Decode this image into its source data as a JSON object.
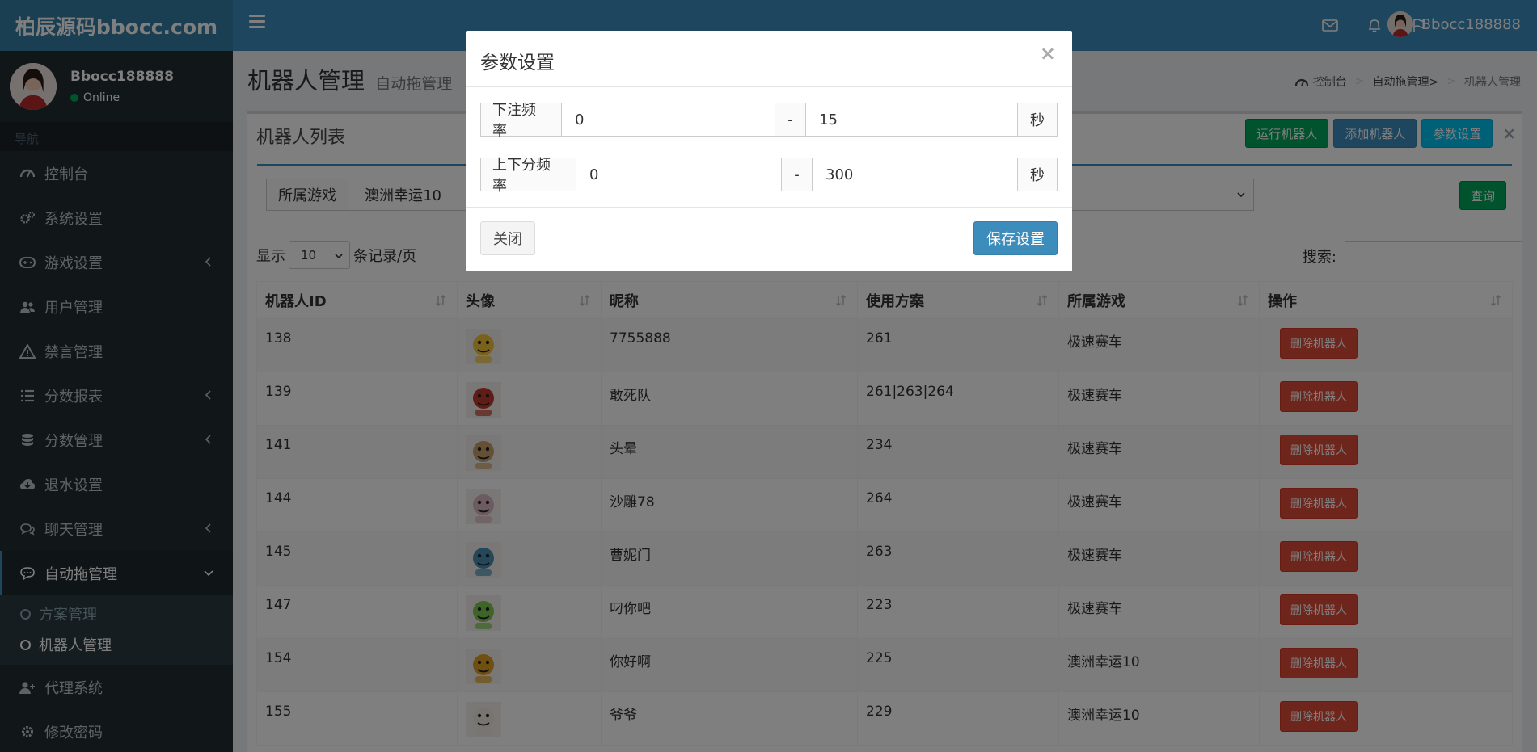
{
  "header": {
    "logo": "柏辰源码bbocc.com",
    "username": "Bbocc188888"
  },
  "sidebar": {
    "user": {
      "name": "Bbocc188888",
      "status": "Online"
    },
    "nav_header": "导航",
    "items": [
      {
        "label": "控制台",
        "icon": "dashboard-icon"
      },
      {
        "label": "系统设置",
        "icon": "cogs-icon"
      },
      {
        "label": "游戏设置",
        "icon": "gamepad-icon"
      },
      {
        "label": "用户管理",
        "icon": "users-icon"
      },
      {
        "label": "禁言管理",
        "icon": "warning-icon"
      },
      {
        "label": "分数报表",
        "icon": "list-icon"
      },
      {
        "label": "分数管理",
        "icon": "database-icon"
      },
      {
        "label": "退水设置",
        "icon": "cloud-download-icon"
      },
      {
        "label": "聊天管理",
        "icon": "comments-icon"
      },
      {
        "label": "自动拖管理",
        "icon": "comment-icon"
      },
      {
        "label": "代理系统",
        "icon": "user-plus-icon"
      },
      {
        "label": "修改密码",
        "icon": "gear-icon"
      }
    ],
    "submenu": [
      {
        "label": "方案管理"
      },
      {
        "label": "机器人管理"
      }
    ]
  },
  "page": {
    "title": "机器人管理",
    "subtitle": "自动拖管理",
    "breadcrumb": [
      "控制台",
      "自动拖管理>",
      "机器人管理"
    ]
  },
  "box": {
    "title": "机器人列表",
    "buttons": {
      "run": "运行机器人",
      "add": "添加机器人",
      "params": "参数设置",
      "close": "×"
    },
    "filter": {
      "label": "所属游戏",
      "value": "澳洲幸运10"
    },
    "query": "查询",
    "length": {
      "prefix": "显示",
      "value": "10",
      "suffix": "条记录/页"
    },
    "search_label": "搜索:"
  },
  "table": {
    "headers": [
      "机器人ID",
      "头像",
      "昵称",
      "使用方案",
      "所属游戏",
      "操作"
    ],
    "delete_label": "删除机器人",
    "rows": [
      {
        "id": "138",
        "nick": "7755888",
        "plan": "261",
        "game": "极速赛车",
        "av": "#f5c53a"
      },
      {
        "id": "139",
        "nick": "敢死队",
        "plan": "261|263|264",
        "game": "极速赛车",
        "av": "#c0392b"
      },
      {
        "id": "141",
        "nick": "头晕",
        "plan": "234",
        "game": "极速赛车",
        "av": "#c9a36b"
      },
      {
        "id": "144",
        "nick": "沙雕78",
        "plan": "264",
        "game": "极速赛车",
        "av": "#d9b7c2"
      },
      {
        "id": "145",
        "nick": "曹妮门",
        "plan": "263",
        "game": "极速赛车",
        "av": "#4a8fb5"
      },
      {
        "id": "147",
        "nick": "叼你吧",
        "plan": "223",
        "game": "极速赛车",
        "av": "#7ec850"
      },
      {
        "id": "154",
        "nick": "你好啊",
        "plan": "225",
        "game": "澳洲幸运10",
        "av": "#e0a020"
      },
      {
        "id": "155",
        "nick": "爷爷",
        "plan": "229",
        "game": "澳洲幸运10",
        "av": "#f0ebe3"
      }
    ]
  },
  "modal": {
    "title": "参数设置",
    "close_x": "×",
    "rows": [
      {
        "label": "下注频率",
        "min": "0",
        "dash": "-",
        "max": "15",
        "unit": "秒"
      },
      {
        "label": "上下分频率",
        "min": "0",
        "dash": "-",
        "max": "300",
        "unit": "秒"
      }
    ],
    "close_btn": "关闭",
    "save_btn": "保存设置"
  }
}
